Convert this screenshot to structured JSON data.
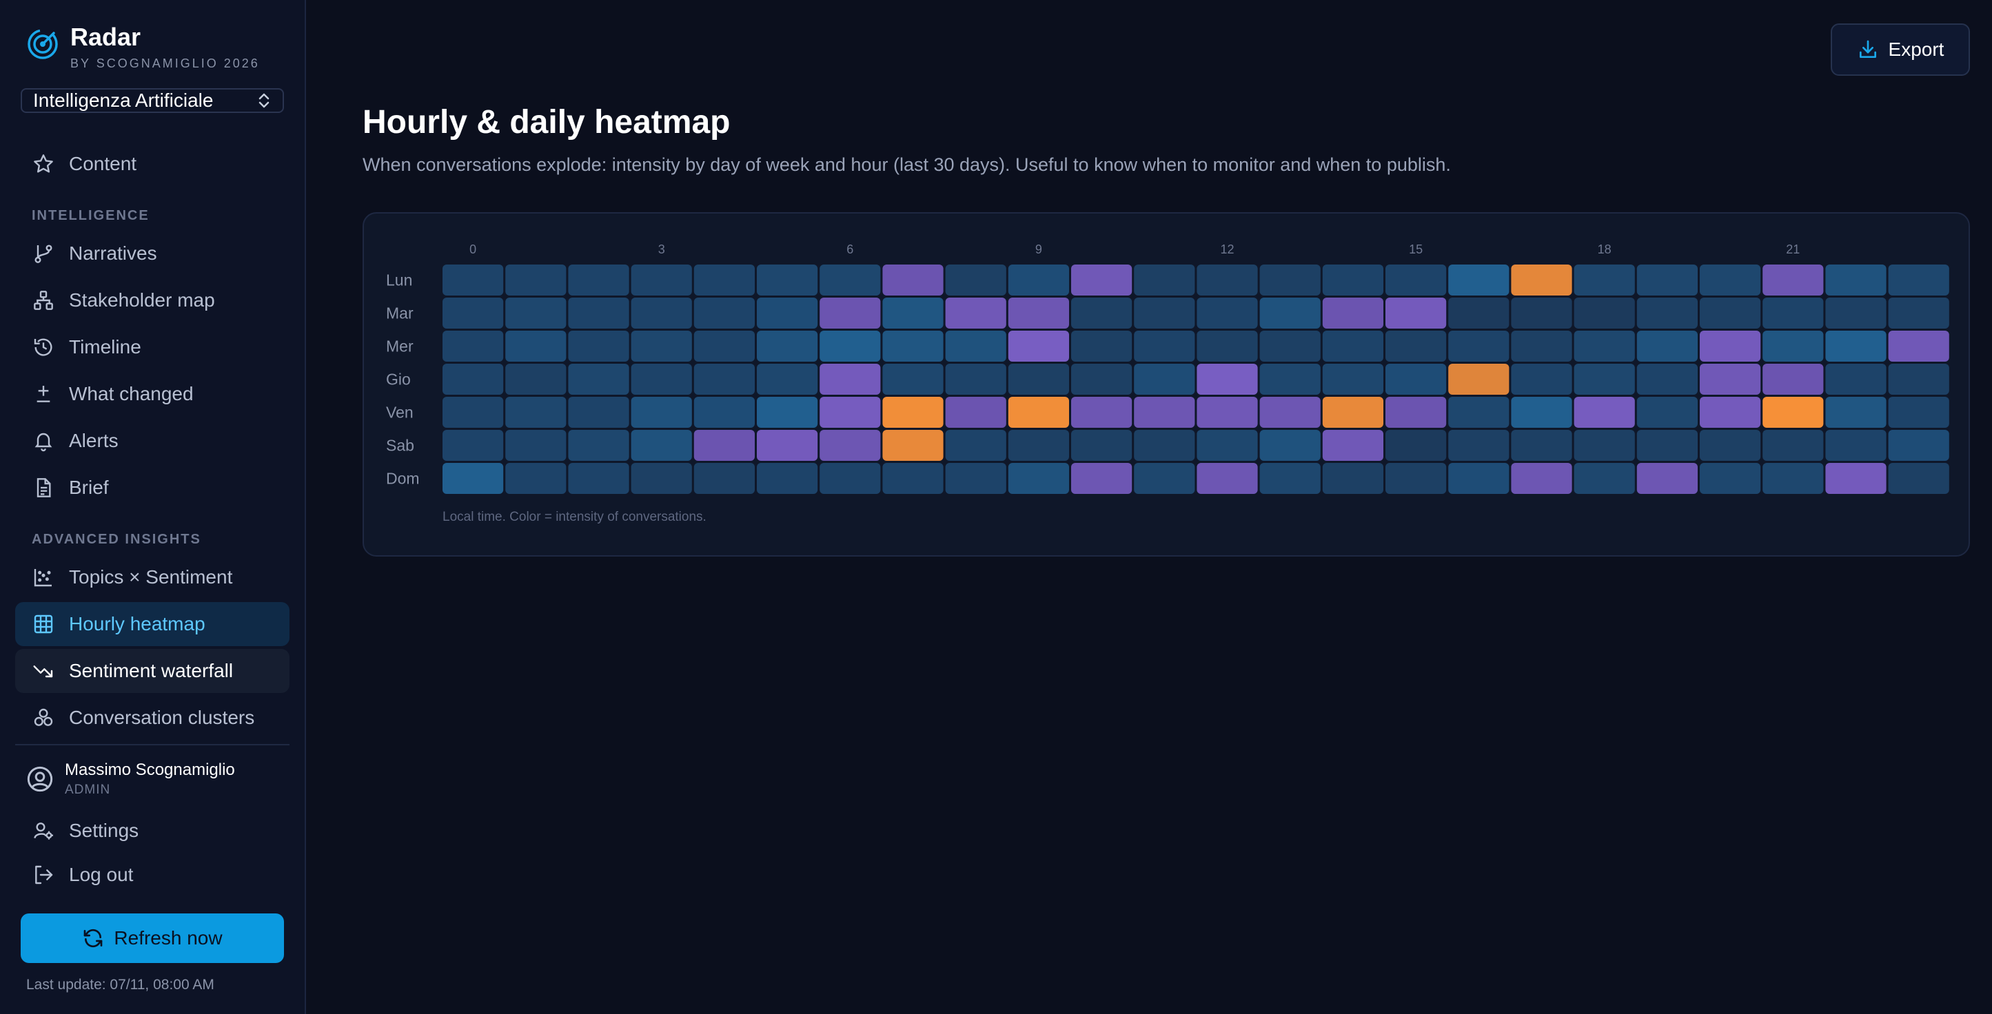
{
  "brand": {
    "title": "Radar",
    "subtitle": "BY SCOGNAMIGLIO 2026"
  },
  "project_select": {
    "value": "Intelligenza Artificiale"
  },
  "nav": {
    "content": "Content",
    "section_intelligence": "INTELLIGENCE",
    "narratives": "Narratives",
    "stakeholder_map": "Stakeholder map",
    "timeline": "Timeline",
    "what_changed": "What changed",
    "alerts": "Alerts",
    "brief": "Brief",
    "section_advanced": "ADVANCED INSIGHTS",
    "topics_sentiment": "Topics × Sentiment",
    "hourly_heatmap": "Hourly heatmap",
    "sentiment_waterfall": "Sentiment waterfall",
    "conversation_clusters": "Conversation clusters"
  },
  "user": {
    "name": "Massimo Scognamiglio",
    "role": "ADMIN"
  },
  "footer": {
    "settings": "Settings",
    "logout": "Log out",
    "refresh": "Refresh now",
    "last_update": "Last update: 07/11, 08:00 AM"
  },
  "header": {
    "export": "Export"
  },
  "page": {
    "title": "Hourly & daily heatmap",
    "subtitle": "When conversations explode: intensity by day of week and hour (last 30 days). Useful to know when to monitor and when to publish.",
    "caption": "Local time. Color = intensity of conversations."
  },
  "colors": {
    "accent": "#0b9ae0",
    "active_nav_text": "#5ec8ff",
    "low": "#1d3a5c",
    "mid": "#7a5cc2",
    "high": "#f08a38"
  },
  "chart_data": {
    "type": "heatmap",
    "x_tick_labels": [
      "0",
      "3",
      "6",
      "9",
      "12",
      "15",
      "18",
      "21"
    ],
    "hours": [
      0,
      1,
      2,
      3,
      4,
      5,
      6,
      7,
      8,
      9,
      10,
      11,
      12,
      13,
      14,
      15,
      16,
      17,
      18,
      19,
      20,
      21,
      22,
      23
    ],
    "days": [
      "Lun",
      "Mar",
      "Mer",
      "Gio",
      "Ven",
      "Sab",
      "Dom"
    ],
    "value_scale": "0-1 relative intensity",
    "values": [
      [
        0.2,
        0.2,
        0.2,
        0.2,
        0.2,
        0.22,
        0.22,
        0.5,
        0.18,
        0.25,
        0.55,
        0.18,
        0.18,
        0.18,
        0.2,
        0.2,
        0.35,
        0.88,
        0.22,
        0.22,
        0.22,
        0.52,
        0.28,
        0.22
      ],
      [
        0.2,
        0.22,
        0.2,
        0.2,
        0.2,
        0.25,
        0.5,
        0.3,
        0.55,
        0.52,
        0.18,
        0.18,
        0.2,
        0.28,
        0.5,
        0.58,
        0.15,
        0.15,
        0.15,
        0.18,
        0.18,
        0.2,
        0.18,
        0.18
      ],
      [
        0.2,
        0.25,
        0.2,
        0.22,
        0.2,
        0.28,
        0.35,
        0.3,
        0.28,
        0.62,
        0.18,
        0.2,
        0.18,
        0.18,
        0.2,
        0.18,
        0.2,
        0.18,
        0.22,
        0.28,
        0.58,
        0.3,
        0.35,
        0.55
      ],
      [
        0.2,
        0.18,
        0.22,
        0.2,
        0.2,
        0.22,
        0.58,
        0.22,
        0.2,
        0.18,
        0.18,
        0.25,
        0.62,
        0.22,
        0.22,
        0.25,
        0.85,
        0.2,
        0.22,
        0.2,
        0.55,
        0.5,
        0.2,
        0.18
      ],
      [
        0.2,
        0.22,
        0.2,
        0.28,
        0.25,
        0.35,
        0.6,
        0.95,
        0.5,
        0.95,
        0.52,
        0.52,
        0.55,
        0.52,
        0.9,
        0.5,
        0.22,
        0.35,
        0.6,
        0.22,
        0.58,
        0.98,
        0.3,
        0.2
      ],
      [
        0.2,
        0.2,
        0.22,
        0.28,
        0.5,
        0.58,
        0.52,
        0.9,
        0.2,
        0.18,
        0.18,
        0.18,
        0.22,
        0.28,
        0.55,
        0.15,
        0.18,
        0.18,
        0.18,
        0.18,
        0.18,
        0.18,
        0.2,
        0.25
      ],
      [
        0.35,
        0.2,
        0.2,
        0.18,
        0.18,
        0.2,
        0.2,
        0.2,
        0.2,
        0.28,
        0.52,
        0.22,
        0.52,
        0.22,
        0.18,
        0.18,
        0.25,
        0.52,
        0.22,
        0.52,
        0.22,
        0.22,
        0.58,
        0.18
      ]
    ]
  }
}
